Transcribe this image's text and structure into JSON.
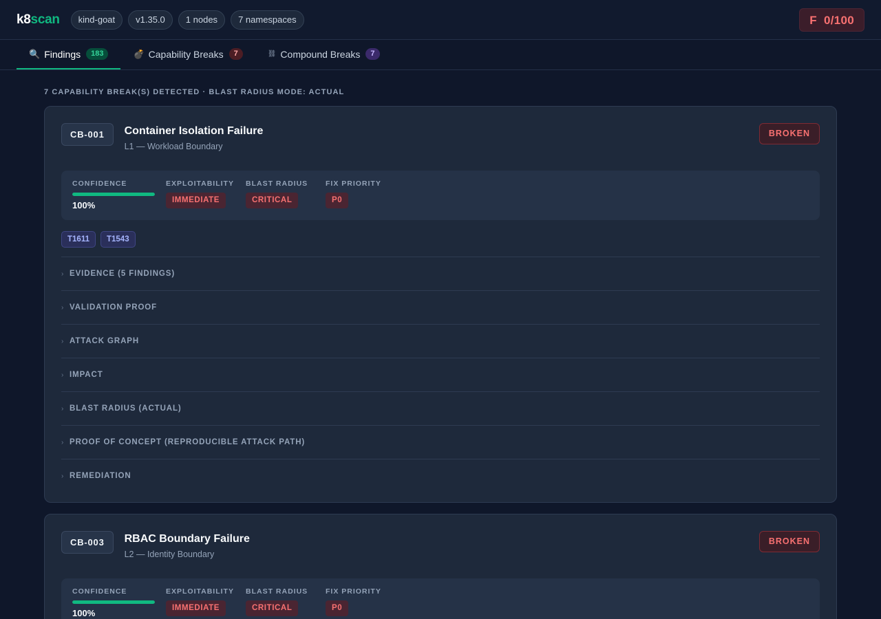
{
  "header": {
    "logo_k8": "k8",
    "logo_scan": "scan",
    "cluster": "kind-goat",
    "version": "v1.35.0",
    "nodes": "1 nodes",
    "namespaces": "7 namespaces",
    "grade": "F  0/100"
  },
  "tabs": [
    {
      "icon": "🔍",
      "label": "Findings",
      "count": "183"
    },
    {
      "icon": "💣",
      "label": "Capability Breaks",
      "count": "7"
    },
    {
      "icon": "⛓",
      "label": "Compound Breaks",
      "count": "7"
    }
  ],
  "main": {
    "section_title": "7 CAPABILITY BREAK(S) DETECTED · BLAST RADIUS MODE: ACTUAL",
    "labels": {
      "confidence": "CONFIDENCE",
      "exploitability": "EXPLOITABILITY",
      "blast_radius": "BLAST RADIUS",
      "fix_priority": "FIX PRIORITY"
    },
    "cards": [
      {
        "id": "CB-001",
        "title": "Container Isolation Failure",
        "subtitle": "L1 — Workload Boundary",
        "status": "BROKEN",
        "confidence": "100%",
        "confidence_fraction": 1.0,
        "exploitability": "IMMEDIATE",
        "blast_radius": "CRITICAL",
        "fix_priority": "P0",
        "mitre": [
          "T1611",
          "T1543"
        ],
        "sections": [
          "EVIDENCE (5 FINDINGS)",
          "VALIDATION PROOF",
          "ATTACK GRAPH",
          "IMPACT",
          "BLAST RADIUS (ACTUAL)",
          "PROOF OF CONCEPT (REPRODUCIBLE ATTACK PATH)",
          "REMEDIATION"
        ]
      },
      {
        "id": "CB-003",
        "title": "RBAC Boundary Failure",
        "subtitle": "L2 — Identity Boundary",
        "status": "BROKEN",
        "confidence": "100%",
        "confidence_fraction": 1.0,
        "exploitability": "IMMEDIATE",
        "blast_radius": "CRITICAL",
        "fix_priority": "P0"
      }
    ]
  },
  "colors": {
    "accent": "#10b981",
    "danger": "#f87171",
    "background": "#0f172a",
    "card": "#1e293b"
  },
  "icons": {
    "findings": "magnifier-icon",
    "capability": "bomb-icon",
    "compound": "chain-icon",
    "chevron": "chevron-right-icon"
  }
}
